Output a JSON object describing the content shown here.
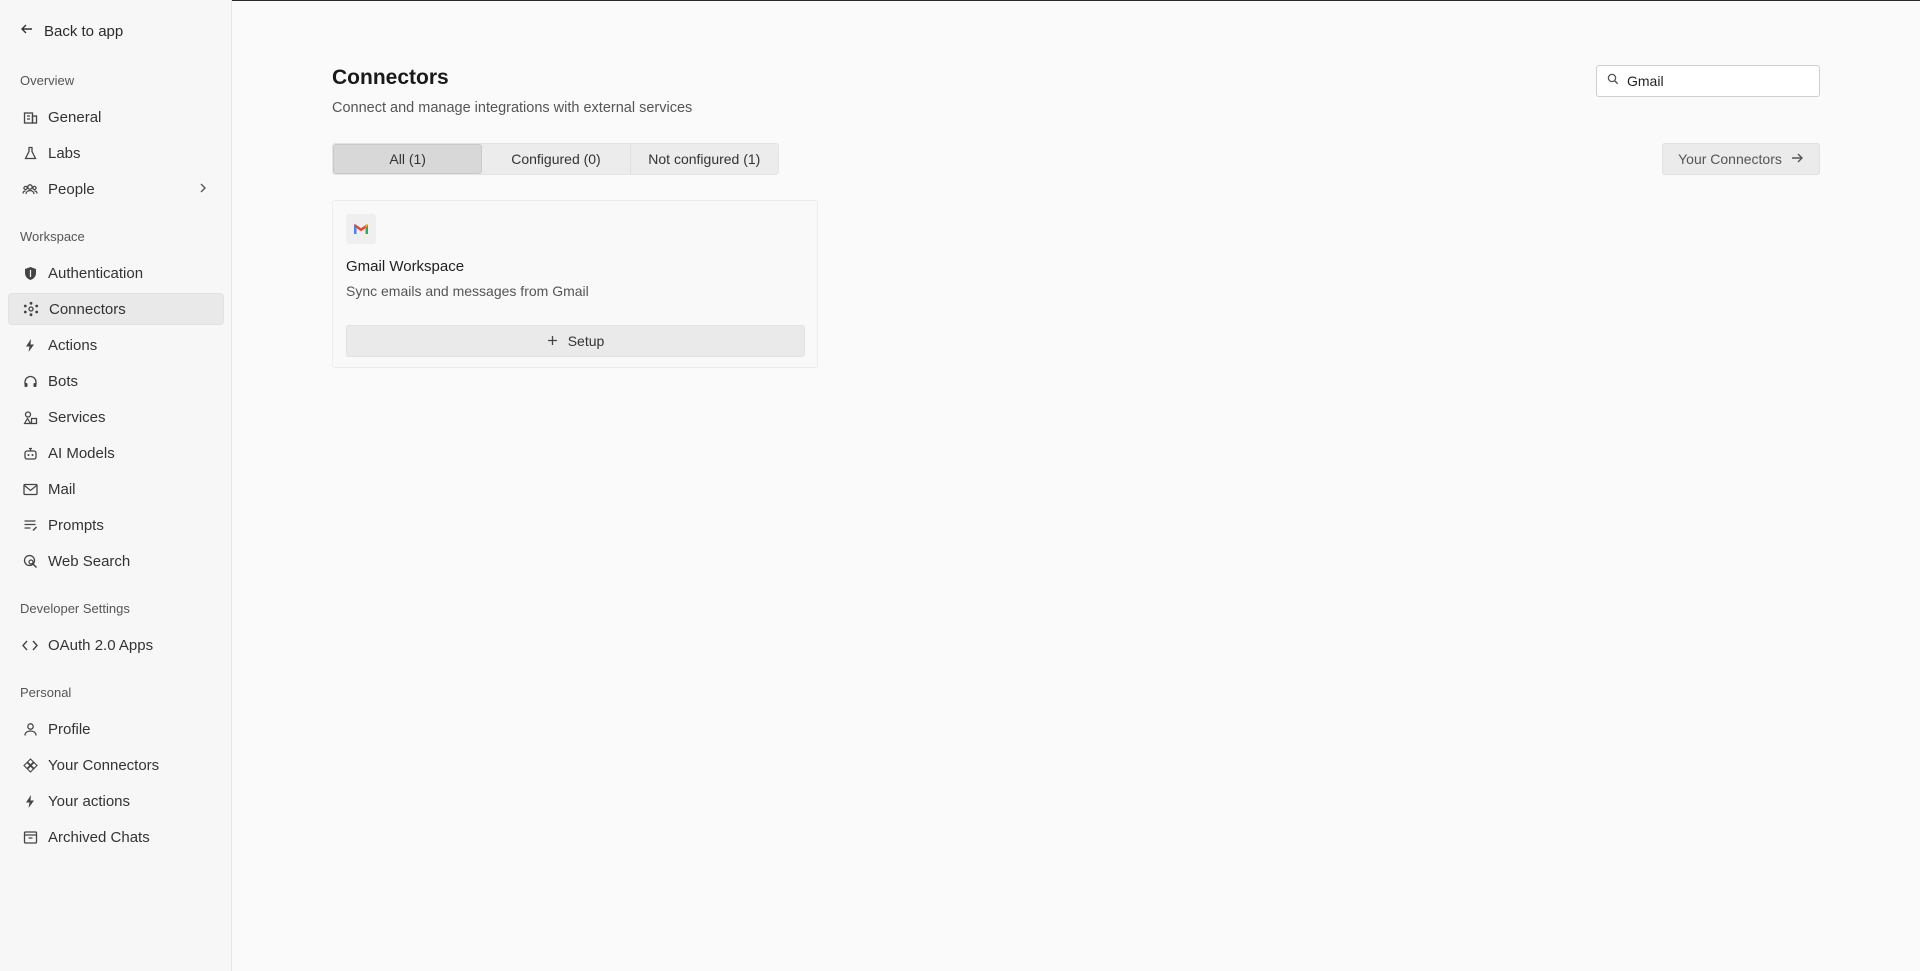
{
  "sidebar": {
    "back_label": "Back to app",
    "sections": [
      {
        "title": "Overview",
        "items": [
          {
            "label": "General",
            "icon": "building-icon"
          },
          {
            "label": "Labs",
            "icon": "flask-icon"
          },
          {
            "label": "People",
            "icon": "people-icon"
          }
        ]
      },
      {
        "title": "Workspace",
        "items": [
          {
            "label": "Authentication",
            "icon": "shield-icon"
          },
          {
            "label": "Connectors",
            "icon": "connectors-icon"
          },
          {
            "label": "Actions",
            "icon": "bolt-icon"
          },
          {
            "label": "Bots",
            "icon": "bot-icon"
          },
          {
            "label": "Services",
            "icon": "services-icon"
          },
          {
            "label": "AI Models",
            "icon": "robot-icon"
          },
          {
            "label": "Mail",
            "icon": "mail-icon"
          },
          {
            "label": "Prompts",
            "icon": "prompts-icon"
          },
          {
            "label": "Web Search",
            "icon": "web-search-icon"
          }
        ]
      },
      {
        "title": "Developer Settings",
        "items": [
          {
            "label": "OAuth 2.0 Apps",
            "icon": "code-icon"
          }
        ]
      },
      {
        "title": "Personal",
        "items": [
          {
            "label": "Profile",
            "icon": "user-icon"
          },
          {
            "label": "Your Connectors",
            "icon": "diamond-grid-icon"
          },
          {
            "label": "Your actions",
            "icon": "bolt-icon"
          },
          {
            "label": "Archived Chats",
            "icon": "archive-icon"
          }
        ]
      }
    ]
  },
  "header": {
    "title": "Connectors",
    "subtitle": "Connect and manage integrations with external services"
  },
  "search": {
    "value": "Gmail",
    "placeholder": "Search"
  },
  "tabs": [
    {
      "label": "All (1)"
    },
    {
      "label": "Configured (0)"
    },
    {
      "label": "Not configured (1)"
    }
  ],
  "your_connectors_label": "Your Connectors",
  "card": {
    "title": "Gmail Workspace",
    "description": "Sync emails and messages from Gmail",
    "setup_label": "Setup",
    "logo": "gmail-icon"
  }
}
